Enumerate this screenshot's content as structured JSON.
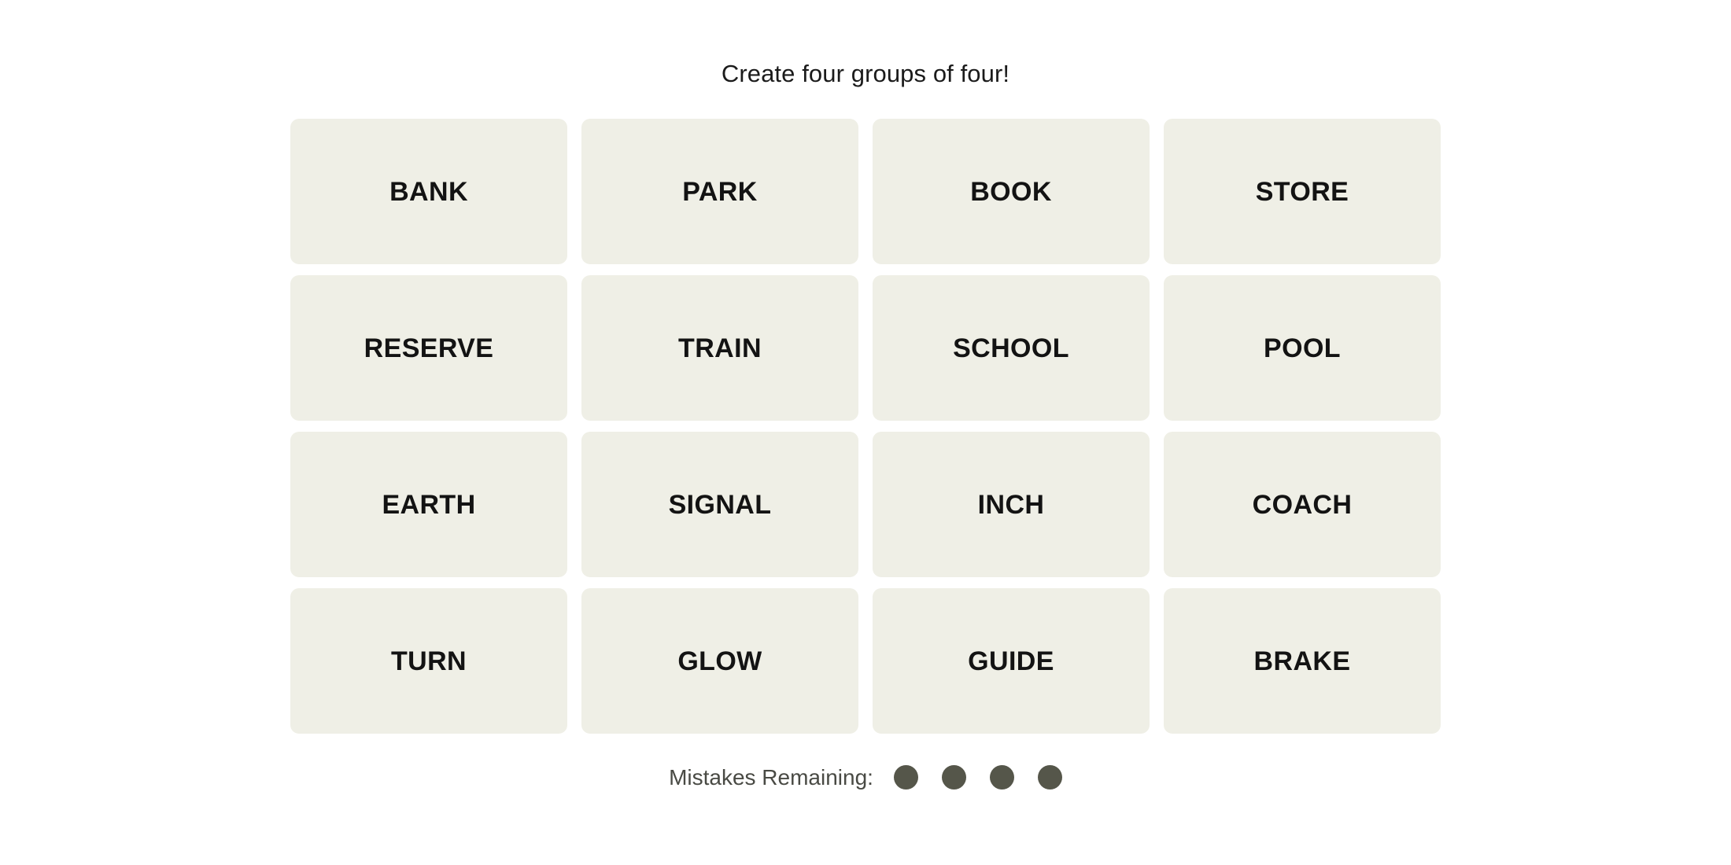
{
  "game": {
    "title": "Create four groups of four!",
    "tile_bg_color": "#EFEFE6",
    "tile_text_color": "#131313",
    "page_bg_color": "#FFFFFF",
    "mistake_dot_color": "#55564A",
    "grid_columns": 4,
    "grid_rows": 4,
    "tiles": [
      {
        "label": "BANK"
      },
      {
        "label": "PARK"
      },
      {
        "label": "BOOK"
      },
      {
        "label": "STORE"
      },
      {
        "label": "RESERVE"
      },
      {
        "label": "TRAIN"
      },
      {
        "label": "SCHOOL"
      },
      {
        "label": "POOL"
      },
      {
        "label": "EARTH"
      },
      {
        "label": "SIGNAL"
      },
      {
        "label": "INCH"
      },
      {
        "label": "COACH"
      },
      {
        "label": "TURN"
      },
      {
        "label": "GLOW"
      },
      {
        "label": "GUIDE"
      },
      {
        "label": "BRAKE"
      }
    ]
  },
  "footer": {
    "mistakes_label": "Mistakes Remaining:",
    "mistakes_remaining": 4,
    "dots": [
      {
        "state": "remaining"
      },
      {
        "state": "remaining"
      },
      {
        "state": "remaining"
      },
      {
        "state": "remaining"
      }
    ]
  }
}
